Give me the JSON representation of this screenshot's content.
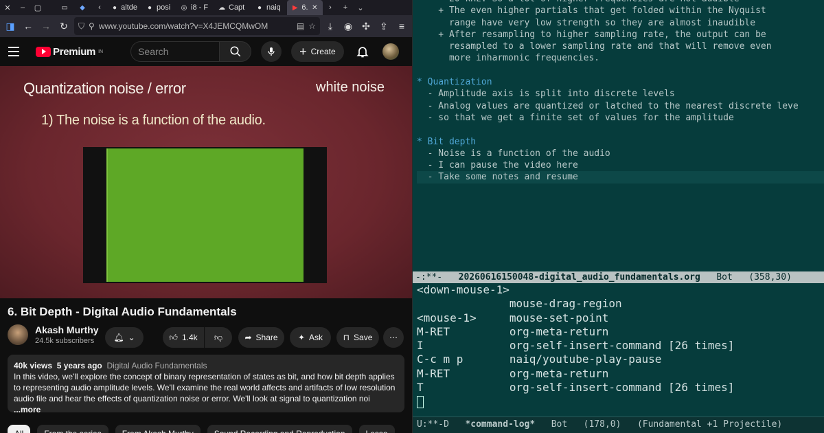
{
  "browser": {
    "tabs": [
      {
        "label": "",
        "icon": "notepad-icon"
      },
      {
        "label": "",
        "icon": "gem-icon"
      },
      {
        "label": "altde",
        "icon": "github-icon"
      },
      {
        "label": "posi",
        "icon": "github-icon"
      },
      {
        "label": "i8 - F",
        "icon": "i8-icon"
      },
      {
        "label": "Capt",
        "icon": "cloud-icon"
      },
      {
        "label": "naiq",
        "icon": "github-icon"
      },
      {
        "label": "6.",
        "icon": "youtube-icon"
      }
    ],
    "url": "www.youtube.com/watch?v=X4JEMCQMwOM"
  },
  "youtube": {
    "brand": "Premium",
    "region": "IN",
    "search_placeholder": "Search",
    "create_label": "Create",
    "video_frame": {
      "title": "Quantization noise / error",
      "corner": "white noise",
      "point": "1) The noise is a function of the audio."
    },
    "video_title": "6. Bit Depth - Digital Audio Fundamentals",
    "channel": {
      "name": "Akash Murthy",
      "subscribers": "24.5k subscribers"
    },
    "actions": {
      "likes": "1.4k",
      "share": "Share",
      "ask": "Ask",
      "save": "Save"
    },
    "description": {
      "views": "40k views",
      "age": "5 years ago",
      "playlist": "Digital Audio Fundamentals",
      "text": "In this video, we'll explore the concept of binary representation of states as bit, and how bit depth applies to representing audio amplitude levels. We'll examine the real world affects and artifacts of low resolution audio file and hear the effects of quantization noise or error. We'll look at signal to quantization noi",
      "more": "...more"
    },
    "chips": [
      "All",
      "From the series",
      "From Akash Murthy",
      "Sound Recording and Reproduction",
      "Lesso"
    ]
  },
  "emacs": {
    "org_lines": [
      {
        "text": "      20 kHz. So a lot of higher frequencies are not audible",
        "type": "body"
      },
      {
        "text": "    + The even higher partials that get folded within the Nyquist",
        "type": "body"
      },
      {
        "text": "      range have very low strength so they are almost inaudible",
        "type": "body"
      },
      {
        "text": "    + After resampling to higher sampling rate, the output can be",
        "type": "body"
      },
      {
        "text": "      resampled to a lower sampling rate and that will remove even",
        "type": "body"
      },
      {
        "text": "      more inharmonic frequencies.",
        "type": "body"
      },
      {
        "text": "",
        "type": "body"
      },
      {
        "text": "* Quantization",
        "type": "heading"
      },
      {
        "text": "  - Amplitude axis is split into discrete levels",
        "type": "body"
      },
      {
        "text": "  - Analog values are quantized or latched to the nearest discrete leve",
        "type": "body"
      },
      {
        "text": "  - so that we get a finite set of values for the amplitude",
        "type": "body"
      },
      {
        "text": "",
        "type": "body"
      },
      {
        "text": "* Bit depth",
        "type": "heading"
      },
      {
        "text": "  - Noise is a function of the audio",
        "type": "body"
      },
      {
        "text": "  - I can pause the video here",
        "type": "body"
      },
      {
        "text": "  - Take some notes and resume",
        "type": "current"
      }
    ],
    "modeline_top": {
      "status": "-:**-",
      "buffer": "20260616150048-digital_audio_fundamentals.org",
      "position": "Bot",
      "coords": "(358,30)"
    },
    "command_log": [
      {
        "key": "<down-mouse-1>",
        "cmd": ""
      },
      {
        "key": "",
        "cmd": "mouse-drag-region"
      },
      {
        "key": "<mouse-1>",
        "cmd": "mouse-set-point"
      },
      {
        "key": "M-RET",
        "cmd": "org-meta-return"
      },
      {
        "key": "I",
        "cmd": "org-self-insert-command [26 times]"
      },
      {
        "key": "C-c m p",
        "cmd": "naiq/youtube-play-pause"
      },
      {
        "key": "M-RET",
        "cmd": "org-meta-return"
      },
      {
        "key": "T",
        "cmd": "org-self-insert-command [26 times]"
      }
    ],
    "modeline_bottom": {
      "status": "U:**-D",
      "buffer": "*command-log*",
      "position": "Bot",
      "coords": "(178,0)",
      "modes": "(Fundamental +1 Projectile)"
    }
  }
}
